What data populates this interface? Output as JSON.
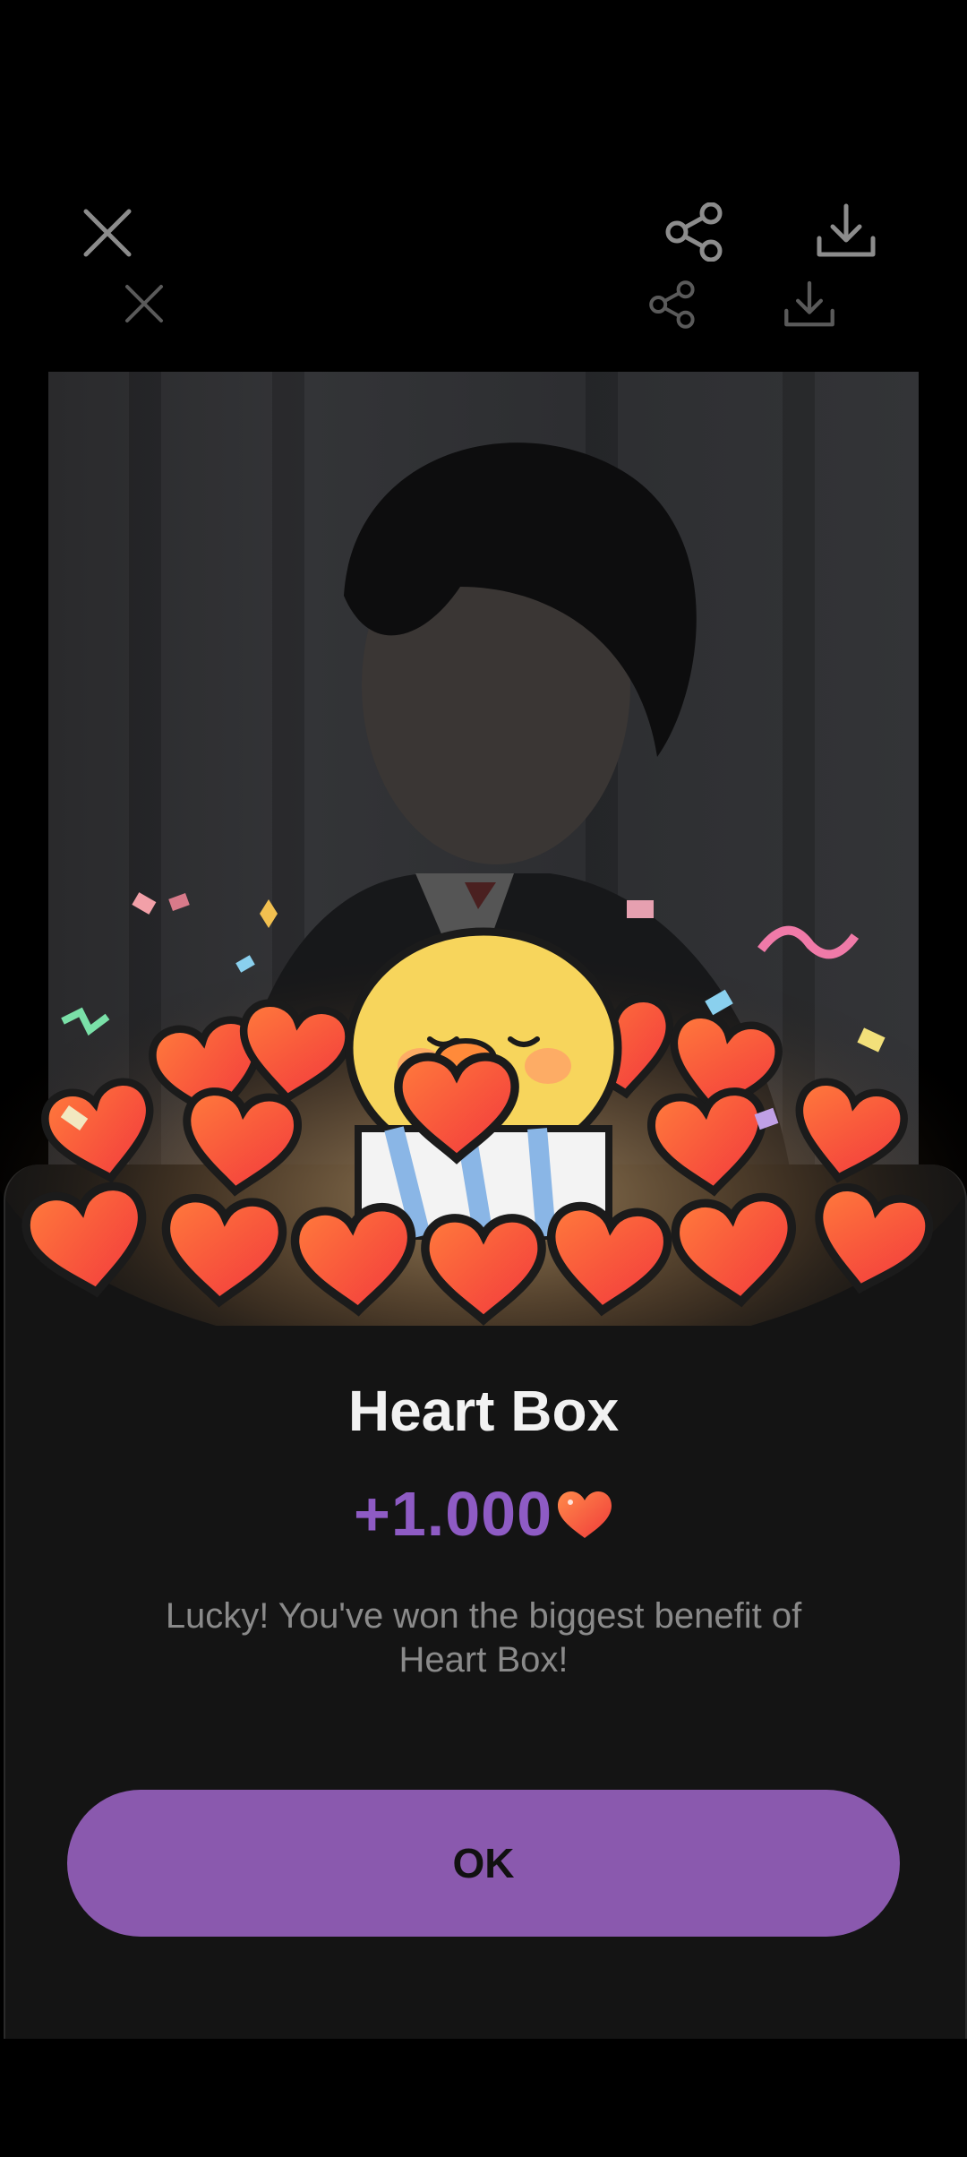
{
  "toolbar": {
    "close_icon": "close-icon",
    "share_icon": "share-icon",
    "download_icon": "download-icon"
  },
  "popup": {
    "title": "Heart Box",
    "amount": "+1.000",
    "amount_icon": "heart-icon",
    "description": "Lucky! You've won the biggest benefit of Heart Box!",
    "ok_label": "OK"
  },
  "colors": {
    "accent": "#8a59ae",
    "amount_text": "#8e5bc4",
    "heart": "#f2533a",
    "sheet_bg": "#141414"
  }
}
